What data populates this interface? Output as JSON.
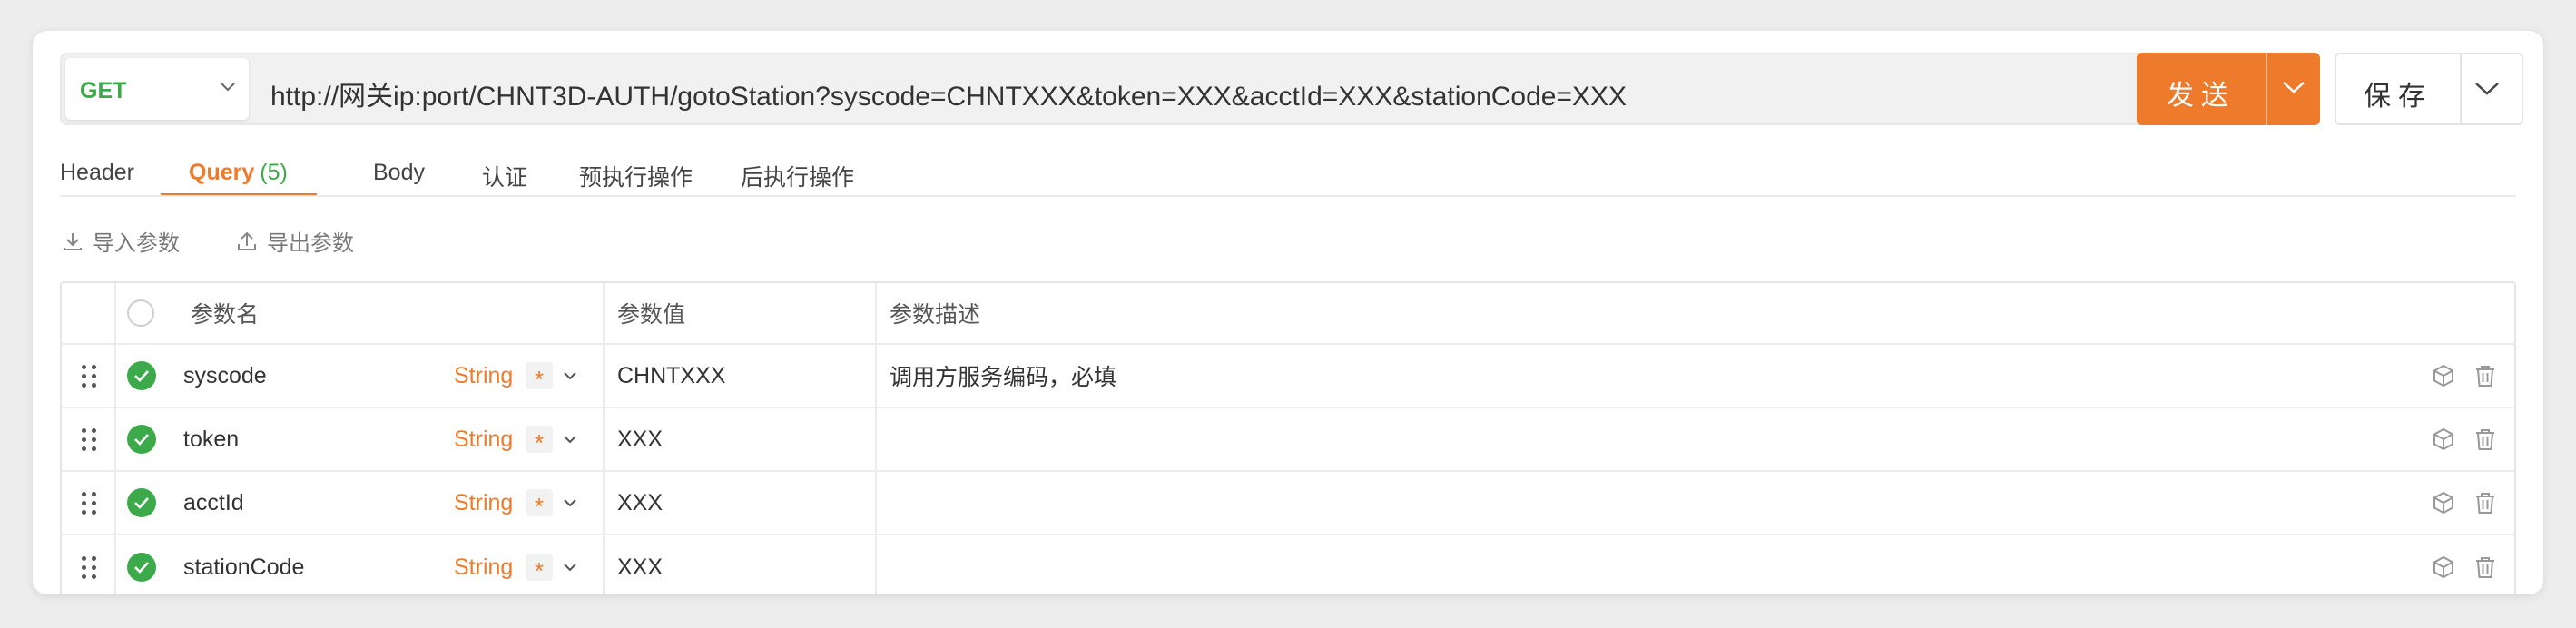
{
  "request": {
    "method": "GET",
    "url": "http://网关ip:port/CHNT3D-AUTH/gotoStation?syscode=CHNTXXX&token=XXX&acctId=XXX&stationCode=XXX",
    "send_label": "发送",
    "save_label": "保存"
  },
  "tabs": [
    {
      "label": "Header"
    },
    {
      "label": "Query",
      "count": "(5)",
      "active": true
    },
    {
      "label": "Body"
    },
    {
      "label": "认证"
    },
    {
      "label": "预执行操作"
    },
    {
      "label": "后执行操作"
    }
  ],
  "actions": {
    "import_label": "导入参数",
    "export_label": "导出参数"
  },
  "table": {
    "headers": {
      "name": "参数名",
      "value": "参数值",
      "desc": "参数描述"
    },
    "rows": [
      {
        "name": "syscode",
        "type": "String",
        "required": "*",
        "value": "CHNTXXX",
        "desc": "调用方服务编码，必填",
        "checked": true
      },
      {
        "name": "token",
        "type": "String",
        "required": "*",
        "value": "XXX",
        "desc": "",
        "checked": true
      },
      {
        "name": "acctId",
        "type": "String",
        "required": "*",
        "value": "XXX",
        "desc": "",
        "checked": true
      },
      {
        "name": "stationCode",
        "type": "String",
        "required": "*",
        "value": "XXX",
        "desc": "",
        "checked": true
      }
    ]
  },
  "colors": {
    "accent": "#ee7b2c",
    "success": "#3caa4a"
  },
  "icons": [
    "chevron-down-icon",
    "import-icon",
    "export-icon",
    "drag-handle-icon",
    "check-circle-icon",
    "cube-icon",
    "trash-icon"
  ]
}
